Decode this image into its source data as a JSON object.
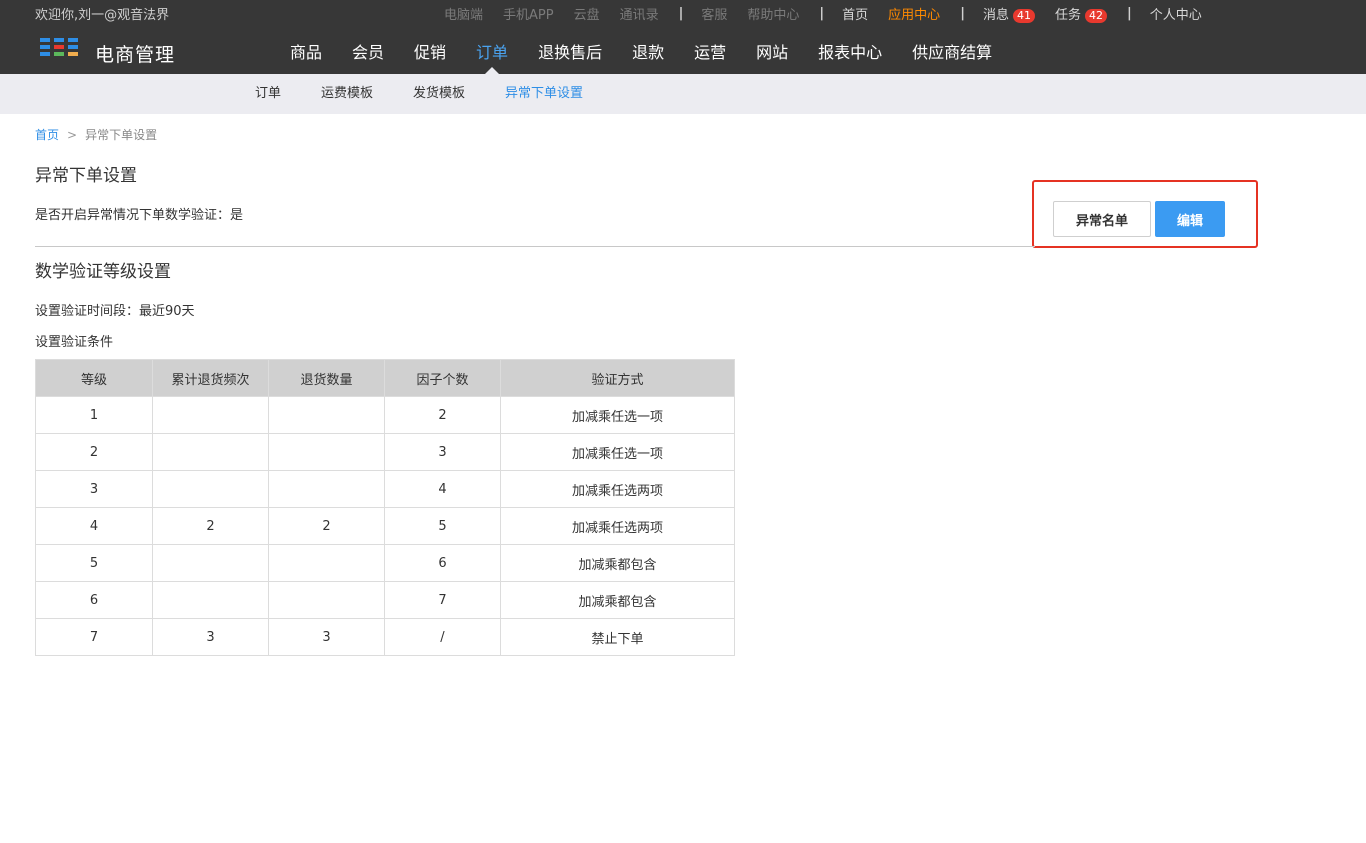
{
  "topbar": {
    "welcome": "欢迎你,刘一@观音法界",
    "links_dim": [
      "电脑端",
      "手机APP",
      "云盘",
      "通讯录"
    ],
    "sep": "|",
    "service": [
      "客服",
      "帮助中心"
    ],
    "home": "首页",
    "app_center": "应用中心",
    "messages": "消息",
    "messages_count": "41",
    "tasks": "任务",
    "tasks_count": "42",
    "personal": "个人中心"
  },
  "brand": {
    "title": "电商管理",
    "logo_colors": [
      "#2e8ee6",
      "#2e8ee6",
      "#2e8ee6",
      "#2e8ee6",
      "#e8392e",
      "#2e8ee6",
      "#2e8ee6",
      "#5cb85c",
      "#f0ad4e"
    ]
  },
  "nav": {
    "items": [
      "商品",
      "会员",
      "促销",
      "订单",
      "退换售后",
      "退款",
      "运营",
      "网站",
      "报表中心",
      "供应商结算"
    ],
    "active_index": 3
  },
  "subnav": {
    "items": [
      "订单",
      "运费模板",
      "发货模板",
      "异常下单设置"
    ],
    "active_index": 3
  },
  "breadcrumb": {
    "home": "首页",
    "sep": ">",
    "current": "异常下单设置"
  },
  "section1": {
    "title": "异常下单设置",
    "setting": "是否开启异常情况下单数学验证：是"
  },
  "actions": {
    "list_button": "异常名单",
    "edit_button": "编辑",
    "highlight_color": "#e53223"
  },
  "section2": {
    "title": "数学验证等级设置",
    "period": "设置验证时间段：最近90天",
    "conditions": "设置验证条件"
  },
  "table": {
    "headers": [
      "等级",
      "累计退货频次",
      "退货数量",
      "因子个数",
      "验证方式"
    ],
    "rows": [
      [
        "1",
        "",
        "",
        "2",
        "加减乘任选一项"
      ],
      [
        "2",
        "",
        "",
        "3",
        "加减乘任选一项"
      ],
      [
        "3",
        "",
        "",
        "4",
        "加减乘任选两项"
      ],
      [
        "4",
        "2",
        "2",
        "5",
        "加减乘任选两项"
      ],
      [
        "5",
        "",
        "",
        "6",
        "加减乘都包含"
      ],
      [
        "6",
        "",
        "",
        "7",
        "加减乘都包含"
      ],
      [
        "7",
        "3",
        "3",
        "/",
        "禁止下单"
      ]
    ]
  },
  "colors": {
    "accent": "#2e8ee6",
    "topbar_bg": "#373737",
    "subnav_bg": "#ececf1",
    "badge": "#e8392e",
    "app_center": "#ff8a00"
  }
}
